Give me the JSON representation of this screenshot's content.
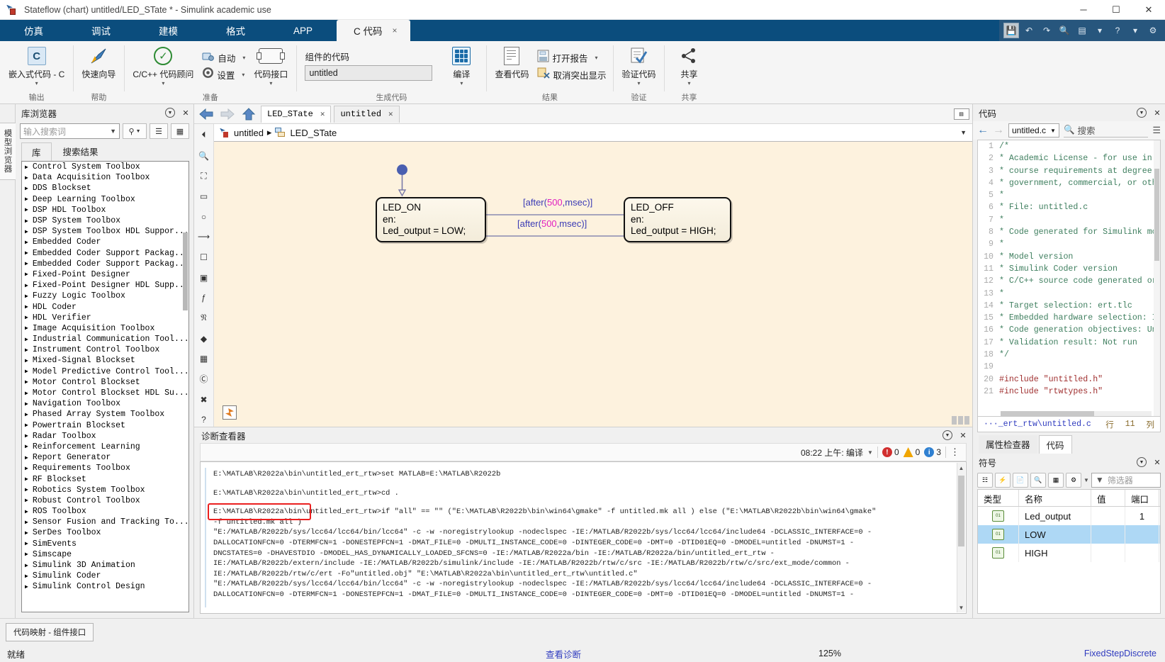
{
  "window": {
    "title": "Stateflow (chart) untitled/LED_STate * - Simulink academic use",
    "minimize": "─",
    "maximize": "☐",
    "close": "✕"
  },
  "ribbon_tabs": [
    {
      "label": "仿真"
    },
    {
      "label": "调试"
    },
    {
      "label": "建模"
    },
    {
      "label": "格式"
    },
    {
      "label": "APP"
    },
    {
      "label": "C 代码",
      "close": "×",
      "active": true
    }
  ],
  "ribbon_right_icons": [
    "save-icon",
    "undo-icon",
    "redo-icon",
    "search-icon",
    "layout-icon",
    "help-icon",
    "settings-icon"
  ],
  "ribbon_groups": [
    {
      "name": "输出",
      "items": [
        {
          "label": "嵌入式代码 - C",
          "icon": "c-code-icon",
          "caret": "▾"
        }
      ]
    },
    {
      "name": "帮助",
      "items": [
        {
          "label": "快速向导",
          "icon": "quick-start-icon"
        }
      ]
    },
    {
      "name": "准备",
      "items": [
        {
          "label": "C/C++ 代码顾问",
          "icon": "code-advisor-icon",
          "caret": "▾"
        },
        {
          "label": "自动",
          "icon": "auto-icon",
          "caret": "▾"
        },
        {
          "label": "设置",
          "icon": "settings-gear-icon",
          "caret": "▾"
        },
        {
          "label": "代码接口",
          "icon": "code-interface-icon",
          "caret": "▾"
        }
      ]
    },
    {
      "name": "生成代码",
      "caption": "组件的代码",
      "field_value": "untitled",
      "items": [
        {
          "label": "编译",
          "icon": "build-icon",
          "caret": "▾"
        }
      ]
    },
    {
      "name": "结果",
      "items": [
        {
          "label": "查看代码",
          "icon": "view-code-icon"
        },
        {
          "label": "打开报告",
          "icon": "open-report-icon",
          "caret": "▾"
        },
        {
          "label": "取消突出显示",
          "icon": "remove-highlight-icon"
        }
      ]
    },
    {
      "name": "验证",
      "items": [
        {
          "label": "验证代码",
          "icon": "verify-code-icon",
          "caret": "▾"
        }
      ]
    },
    {
      "name": "共享",
      "items": [
        {
          "label": "共享",
          "icon": "share-icon",
          "caret": "▾"
        }
      ]
    }
  ],
  "left_strip": {
    "label": "模型浏览器"
  },
  "library": {
    "title": "库浏览器",
    "search_placeholder": "输入搜索词",
    "tabs": [
      {
        "label": "库",
        "active": true
      },
      {
        "label": "搜索结果",
        "active": false
      }
    ],
    "items": [
      "Control System Toolbox",
      "Data Acquisition Toolbox",
      "DDS Blockset",
      "Deep Learning Toolbox",
      "DSP HDL Toolbox",
      "DSP System Toolbox",
      "DSP System Toolbox HDL Suppor...",
      "Embedded Coder",
      "Embedded Coder Support Packag...",
      "Embedded Coder Support Packag...",
      "Fixed-Point Designer",
      "Fixed-Point Designer HDL Supp...",
      "Fuzzy Logic Toolbox",
      "HDL Coder",
      "HDL Verifier",
      "Image Acquisition Toolbox",
      "Industrial Communication Tool...",
      "Instrument Control Toolbox",
      "Mixed-Signal Blockset",
      "Model Predictive Control Tool...",
      "Motor Control Blockset",
      "Motor Control Blockset HDL Su...",
      "Navigation Toolbox",
      "Phased Array System Toolbox",
      "Powertrain Blockset",
      "Radar Toolbox",
      "Reinforcement Learning",
      "Report Generator",
      "Requirements Toolbox",
      "RF Blockset",
      "Robotics System Toolbox",
      "Robust Control Toolbox",
      "ROS Toolbox",
      "Sensor Fusion and Tracking To...",
      "SerDes Toolbox",
      "SimEvents",
      "Simscape",
      "Simulink 3D Animation",
      "Simulink Coder",
      "Simulink Control Design"
    ]
  },
  "editor": {
    "file_tabs": [
      {
        "label": "LED_STate",
        "close": "✕",
        "active": true
      },
      {
        "label": "untitled",
        "close": "✕",
        "active": false
      }
    ],
    "breadcrumb": [
      "untitled",
      "LED_STate"
    ],
    "breadcrumb_sep": "▸",
    "chart": {
      "states": [
        {
          "name": "LED_ON",
          "action_label": "en:",
          "action": "Led_output = LOW;"
        },
        {
          "name": "LED_OFF",
          "action_label": "en:",
          "action": "Led_output = HIGH;"
        }
      ],
      "transitions": [
        {
          "prefix": "[after(",
          "value": "500",
          "suffix": ",msec)]"
        },
        {
          "prefix": "[after(",
          "value": "500",
          "suffix": ",msec)]"
        }
      ]
    }
  },
  "diagnostic": {
    "title": "诊断查看器",
    "filter": "08:22 上午: 编译",
    "error_count": "0",
    "warning_count": "0",
    "info_count": "3",
    "lines": [
      "E:\\MATLAB\\R2022a\\bin\\untitled_ert_rtw>set MATLAB=E:\\MATLAB\\R2022b",
      "E:\\MATLAB\\R2022a\\bin\\untitled_ert_rtw>cd .",
      "E:\\MATLAB\\R2022a\\bin\\untitled_ert_rtw>if \"all\" == \"\" (\"E:\\MATLAB\\R2022b\\bin\\win64\\gmake\"  -f untitled.mk all )  else (\"E:\\MATLAB\\R2022b\\bin\\win64\\gmake\"",
      "-f untitled.mk all )",
      "\"E:/MATLAB/R2022b/sys/lcc64/lcc64/bin/lcc64\" -c -w -noregistrylookup -nodeclspec -IE:/MATLAB/R2022b/sys/lcc64/lcc64/include64 -DCLASSIC_INTERFACE=0 -",
      "DALLOCATIONFCN=0 -DTERMFCN=1 -DONESTEPFCN=1 -DMAT_FILE=0 -DMULTI_INSTANCE_CODE=0 -DINTEGER_CODE=0 -DMT=0  -DTID01EQ=0 -DMODEL=untitled -DNUMST=1 -",
      "DNCSTATES=0 -DHAVESTDIO -DMODEL_HAS_DYNAMICALLY_LOADED_SFCNS=0 -IE:/MATLAB/R2022a/bin -IE:/MATLAB/R2022a/bin/untitled_ert_rtw -",
      "IE:/MATLAB/R2022b/extern/include -IE:/MATLAB/R2022b/simulink/include -IE:/MATLAB/R2022b/rtw/c/src -IE:/MATLAB/R2022b/rtw/c/src/ext_mode/common -",
      "IE:/MATLAB/R2022b/rtw/c/ert -Fo\"untitled.obj\" \"E:\\MATLAB\\R2022a\\bin\\untitled_ert_rtw\\untitled.c\"",
      "\"E:/MATLAB/R2022b/sys/lcc64/lcc64/bin/lcc64\" -c -w -noregistrylookup -nodeclspec -IE:/MATLAB/R2022b/sys/lcc64/lcc64/include64 -DCLASSIC_INTERFACE=0 -",
      "DALLOCATIONFCN=0 -DTERMFCN=1 -DONESTEPFCN=1 -DMAT_FILE=0 -DMULTI_INSTANCE_CODE=0 -DINTEGER_CODE=0 -DMT=0  -DTID01EQ=0 -DMODEL=untitled -DNUMST=1 -"
    ]
  },
  "code_panel": {
    "title": "代码",
    "file_select": "untitled.c",
    "search_label": "搜索",
    "lines": [
      {
        "no": "1",
        "text": "/*",
        "kind": "cm"
      },
      {
        "no": "2",
        "text": " * Academic License - for use in",
        "kind": "cm"
      },
      {
        "no": "3",
        "text": " * course requirements at degree",
        "kind": "cm"
      },
      {
        "no": "4",
        "text": " * government, commercial, or oth",
        "kind": "cm"
      },
      {
        "no": "5",
        "text": " *",
        "kind": "cm"
      },
      {
        "no": "6",
        "text": " * File: untitled.c",
        "kind": "cm"
      },
      {
        "no": "7",
        "text": " *",
        "kind": "cm"
      },
      {
        "no": "8",
        "text": " * Code generated for Simulink mo",
        "kind": "cm"
      },
      {
        "no": "9",
        "text": " *",
        "kind": "cm"
      },
      {
        "no": "10",
        "text": " * Model version",
        "kind": "cm"
      },
      {
        "no": "11",
        "text": " * Simulink Coder version",
        "kind": "cm"
      },
      {
        "no": "12",
        "text": " * C/C++ source code generated or",
        "kind": "cm"
      },
      {
        "no": "13",
        "text": " *",
        "kind": "cm"
      },
      {
        "no": "14",
        "text": " * Target selection: ert.tlc",
        "kind": "cm"
      },
      {
        "no": "15",
        "text": " * Embedded hardware selection: I",
        "kind": "cm"
      },
      {
        "no": "16",
        "text": " * Code generation objectives: Un",
        "kind": "cm"
      },
      {
        "no": "17",
        "text": " * Validation result: Not run",
        "kind": "cm"
      },
      {
        "no": "18",
        "text": " */",
        "kind": "cm"
      },
      {
        "no": "19",
        "text": "",
        "kind": ""
      },
      {
        "no": "20",
        "text": "#include \"untitled.h\"",
        "kind": "pp"
      },
      {
        "no": "21",
        "text": "#include \"rtwtypes.h\"",
        "kind": "pp"
      }
    ],
    "status_file": "···_ert_rtw\\untitled.c",
    "status_row_label": "行",
    "status_row_value": "11",
    "status_col_label": "列"
  },
  "dock_tabs": [
    {
      "label": "属性检查器",
      "active": false
    },
    {
      "label": "代码",
      "active": true
    }
  ],
  "symbols": {
    "title": "符号",
    "filter_placeholder": "筛选器",
    "columns": [
      "类型",
      "名称",
      "值",
      "端口"
    ],
    "rows": [
      {
        "type_icon": "output-var-icon",
        "name": "Led_output",
        "value": "",
        "port": "1",
        "selected": false
      },
      {
        "type_icon": "constant-var-icon",
        "name": "LOW",
        "value": "",
        "port": "",
        "selected": true
      },
      {
        "type_icon": "constant-var-icon",
        "name": "HIGH",
        "value": "",
        "port": "",
        "selected": false
      }
    ]
  },
  "bottom": {
    "code_mapping_button": "代码映射 - 组件接口",
    "status_ready": "就绪",
    "status_view_diag": "查看诊断",
    "status_zoom": "125%",
    "status_solver": "FixedStepDiscrete"
  }
}
